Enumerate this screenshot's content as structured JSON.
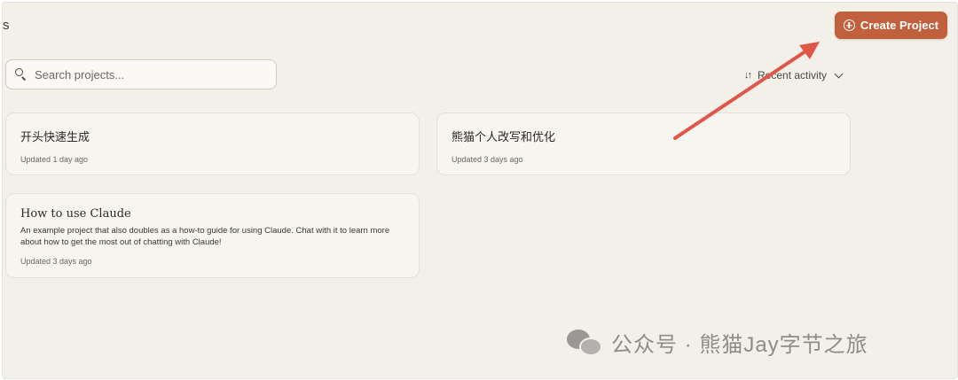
{
  "header": {
    "title_stub": "s",
    "create_label": "Create Project"
  },
  "search": {
    "placeholder": "Search projects..."
  },
  "sort": {
    "label": "Recent activity"
  },
  "projects": [
    {
      "title": "开头快速生成",
      "updated": "Updated 1 day ago"
    },
    {
      "title": "熊猫个人改写和优化",
      "updated": "Updated 3 days ago"
    },
    {
      "title": "How to use Claude",
      "description": "An example project that also doubles as a how-to guide for using Claude. Chat with it to learn more about how to get the most out of chatting with Claude!",
      "updated": "Updated 3 days ago"
    }
  ],
  "watermark": {
    "text": "公众号 · 熊猫Jay字节之旅"
  },
  "colors": {
    "accent": "#c1603c",
    "arrow": "#e0574a",
    "background": "#f3f0e9"
  }
}
